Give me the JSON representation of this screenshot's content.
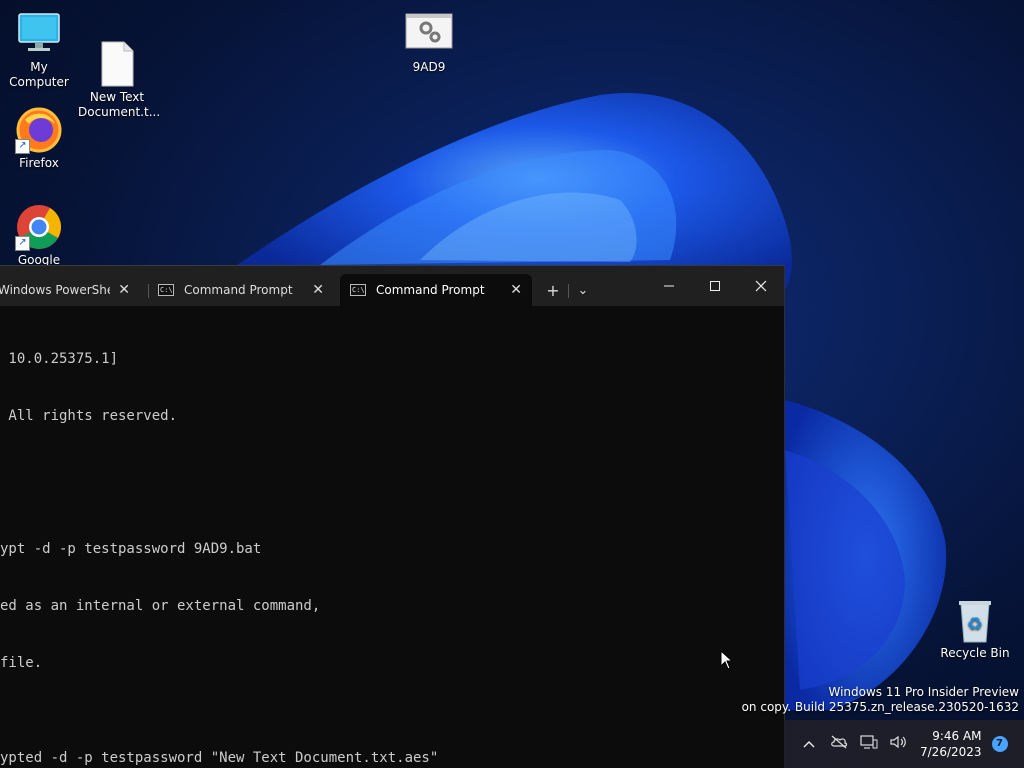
{
  "desktop": {
    "icons": [
      {
        "label": "My Computer"
      },
      {
        "label": "New Text\nDocument.t..."
      },
      {
        "label": "9AD9"
      },
      {
        "label": "Firefox"
      },
      {
        "label": "Google"
      },
      {
        "label": "Recycle Bin"
      }
    ]
  },
  "terminal": {
    "tabs": [
      {
        "title": "Windows PowerShell"
      },
      {
        "title": "Command Prompt"
      },
      {
        "title": "Command Prompt"
      }
    ],
    "new_tab_label": "+",
    "dropdown_label": "⌄",
    "lines": [
      " 10.0.25375.1]",
      " All rights reserved.",
      "",
      "",
      "ypt -d -p testpassword 9AD9.bat",
      "ed as an internal or external command,",
      "file.",
      "",
      "ypted -d -p testpassword \"New Text Document.txt.aes\""
    ],
    "colors": {
      "background": "#0c0c0c",
      "text": "#cccccc",
      "tabbar": "#202020"
    }
  },
  "watermark": {
    "line1": "Windows 11 Pro Insider Preview",
    "line2": "on copy. Build 25375.zn_release.230520-1632"
  },
  "taskbar": {
    "time": "9:46 AM",
    "date": "7/26/2023",
    "notification_count": "7"
  }
}
